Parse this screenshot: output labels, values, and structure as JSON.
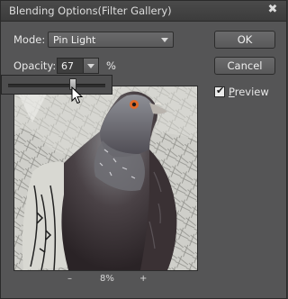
{
  "window": {
    "title": "Blending Options(Filter Gallery)",
    "close_glyph": "✖"
  },
  "mode": {
    "label": "Mode:",
    "value": "Pin Light"
  },
  "opacity": {
    "label": "Opacity:",
    "value": "67",
    "unit": "%",
    "level": 0.67
  },
  "buttons": {
    "ok": "OK",
    "cancel": "Cancel"
  },
  "preview": {
    "label": "Preview",
    "checked": true
  },
  "zoom": {
    "minus": "–",
    "value": "8%",
    "plus": "+"
  },
  "colors": {
    "dialog_bg": "#555556",
    "titlebar_bg": "#3c3c3c",
    "eye_color": "#e06a2a"
  }
}
